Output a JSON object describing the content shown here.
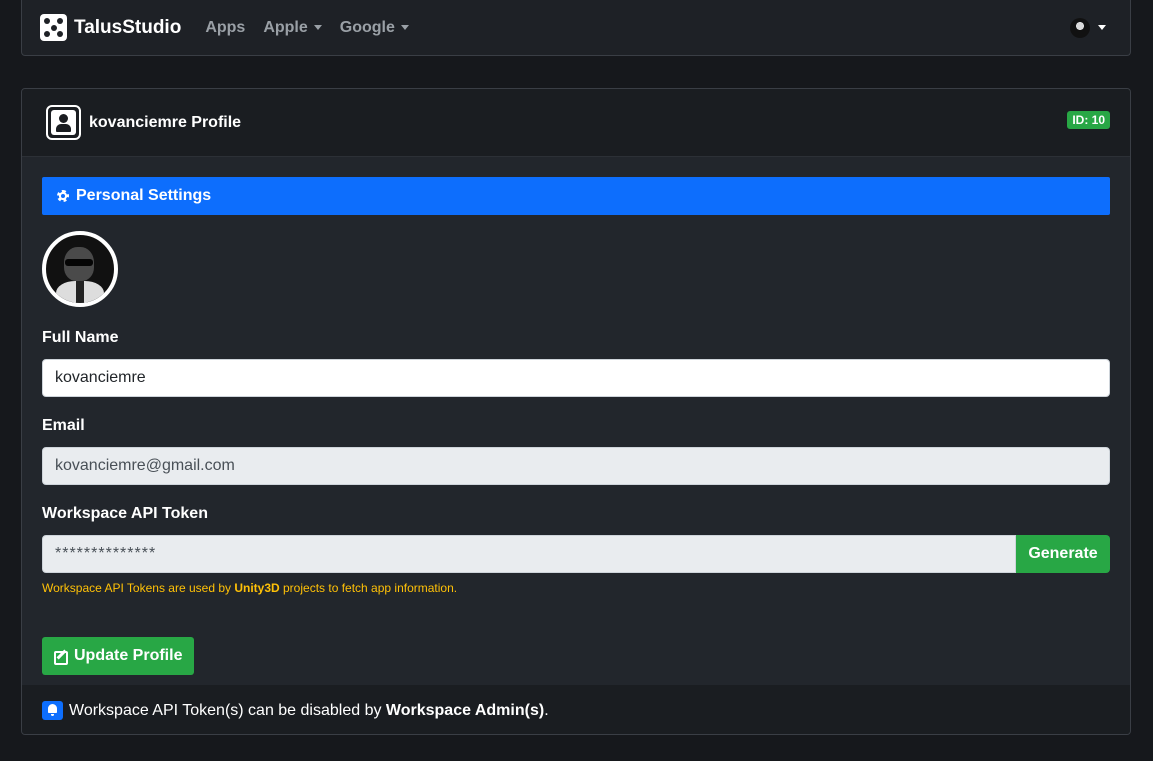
{
  "navbar": {
    "brand": "TalusStudio",
    "links": [
      "Apps",
      "Apple",
      "Google"
    ]
  },
  "card": {
    "title": "kovanciemre Profile",
    "id_badge": "ID: 10",
    "section_title": "Personal Settings",
    "full_name_label": "Full Name",
    "full_name_value": "kovanciemre",
    "email_label": "Email",
    "email_value": "kovanciemre@gmail.com",
    "token_label": "Workspace API Token",
    "token_value": "**************",
    "generate_label": "Generate",
    "help_text_1": "Workspace API Tokens are used by ",
    "help_text_bold": "Unity3D",
    "help_text_2": " projects to fetch app information.",
    "update_label": "Update Profile",
    "footer_text_1": "Workspace API Token(s) can be disabled by ",
    "footer_text_bold": "Workspace Admin(s)",
    "footer_text_2": "."
  },
  "colors": {
    "primary": "#0d6efd",
    "success": "#28a745",
    "warning": "#ffc107",
    "background": "#16181c"
  }
}
